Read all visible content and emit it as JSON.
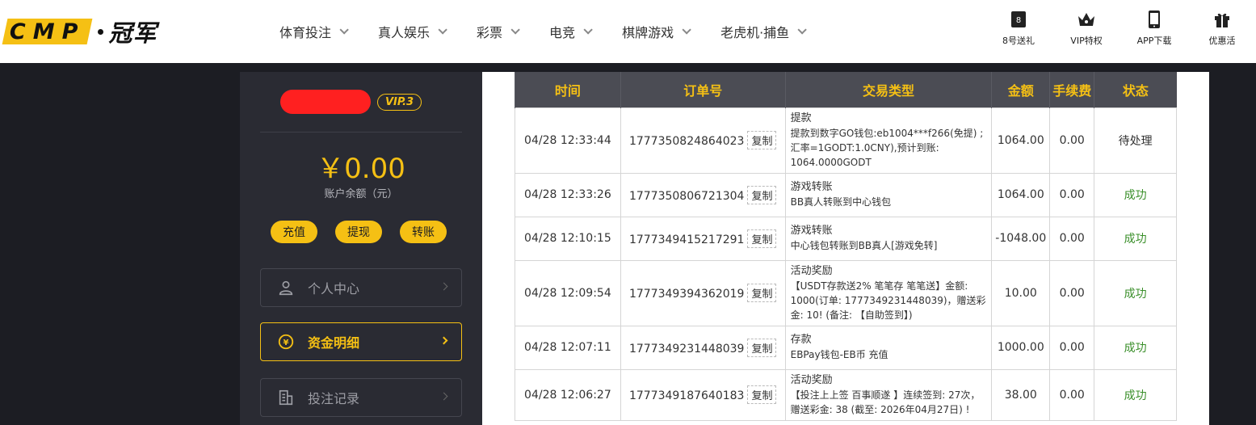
{
  "header": {
    "logo_latin": "CMP",
    "logo_cn": "冠军",
    "nav": [
      {
        "label": "体育投注"
      },
      {
        "label": "真人娱乐"
      },
      {
        "label": "彩票"
      },
      {
        "label": "电竞"
      },
      {
        "label": "棋牌游戏"
      },
      {
        "label": "老虎机·捕鱼"
      }
    ],
    "right": [
      {
        "label": "8号送礼",
        "icon": "ticket-icon"
      },
      {
        "label": "VIP特权",
        "icon": "crown-icon"
      },
      {
        "label": "APP下载",
        "icon": "phone-icon"
      },
      {
        "label": "优惠活",
        "icon": "gift-icon"
      }
    ]
  },
  "sidebar": {
    "vip": "VIP.3",
    "balance": "￥0.00",
    "balance_label": "账户余额（元）",
    "buttons": {
      "deposit": "充值",
      "withdraw": "提现",
      "transfer": "转账"
    },
    "menu": [
      {
        "label": "个人中心",
        "icon": "user-icon"
      },
      {
        "label": "资金明细",
        "icon": "yen-coin-icon"
      },
      {
        "label": "投注记录",
        "icon": "bet-record-icon"
      }
    ]
  },
  "table": {
    "headers": [
      "时间",
      "订单号",
      "交易类型",
      "金额",
      "手续费",
      "状态"
    ],
    "copy_label": "复制",
    "rows": [
      {
        "time": "04/28 12:33:44",
        "order": "1777350824864023",
        "type": "提款",
        "desc": "提款到数字GO钱包:eb1004***f266(免提) ;汇率=1GODT:1.0CNY),预计到账: 1064.0000GODT",
        "amount": "1064.00",
        "fee": "0.00",
        "status": "待处理"
      },
      {
        "time": "04/28 12:33:26",
        "order": "1777350806721304",
        "type": "游戏转账",
        "desc": "BB真人转账到中心钱包",
        "amount": "1064.00",
        "fee": "0.00",
        "status": "成功"
      },
      {
        "time": "04/28 12:10:15",
        "order": "1777349415217291",
        "type": "游戏转账",
        "desc": "中心钱包转账到BB真人[游戏免转]",
        "amount": "-1048.00",
        "fee": "0.00",
        "status": "成功"
      },
      {
        "time": "04/28 12:09:54",
        "order": "1777349394362019",
        "type": "活动奖励",
        "desc": "【USDT存款送2% 笔笔存 笔笔送】金额: 1000(订单: 1777349231448039)，赠送彩金: 10! (备注: 【自助签到】)",
        "amount": "10.00",
        "fee": "0.00",
        "status": "成功"
      },
      {
        "time": "04/28 12:07:11",
        "order": "1777349231448039",
        "type": "存款",
        "desc": "EBPay钱包-EB币 充值",
        "amount": "1000.00",
        "fee": "0.00",
        "status": "成功"
      },
      {
        "time": "04/28 12:06:27",
        "order": "1777349187640183",
        "type": "活动奖励",
        "desc": "【投注上上签 百事顺遂 】连续签到: 27次，赠送彩金: 38 (截至: 2026年04月27日) !",
        "amount": "38.00",
        "fee": "0.00",
        "status": "成功"
      }
    ]
  },
  "colors": {
    "accent": "#f5c014",
    "success": "#3a8f2a",
    "dark": "#1c1d23"
  }
}
